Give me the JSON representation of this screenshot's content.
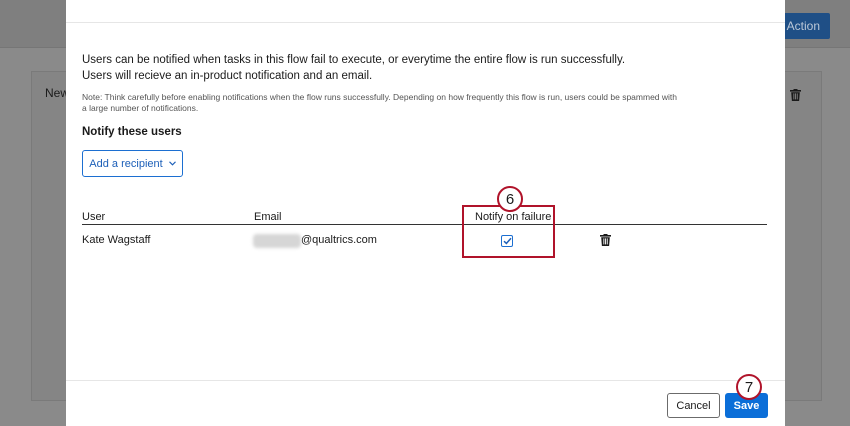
{
  "background": {
    "action_button": "Action",
    "card_label": "New"
  },
  "modal": {
    "description": "Users can be notified when tasks in this flow fail to execute, or everytime the entire flow is run successfully. Users will recieve an in-product notification and an email.",
    "note": "Note: Think carefully before enabling notifications when the flow runs successfully. Depending on how frequently this flow is run, users could be spammed with a large number of notifications.",
    "section_title": "Notify these users",
    "add_recipient_label": "Add a recipient",
    "table": {
      "headers": [
        "User",
        "Email",
        "Notify on failure"
      ],
      "rows": [
        {
          "user": "Kate Wagstaff",
          "email_domain": "@qualtrics.com",
          "notify_on_failure": true
        }
      ]
    },
    "footer": {
      "cancel_label": "Cancel",
      "save_label": "Save"
    }
  },
  "annotations": {
    "step_a": "6",
    "step_b": "7",
    "color": "#b0132a"
  },
  "colors": {
    "primary": "#0b6ed8",
    "overlay": "#8a8a8a"
  }
}
